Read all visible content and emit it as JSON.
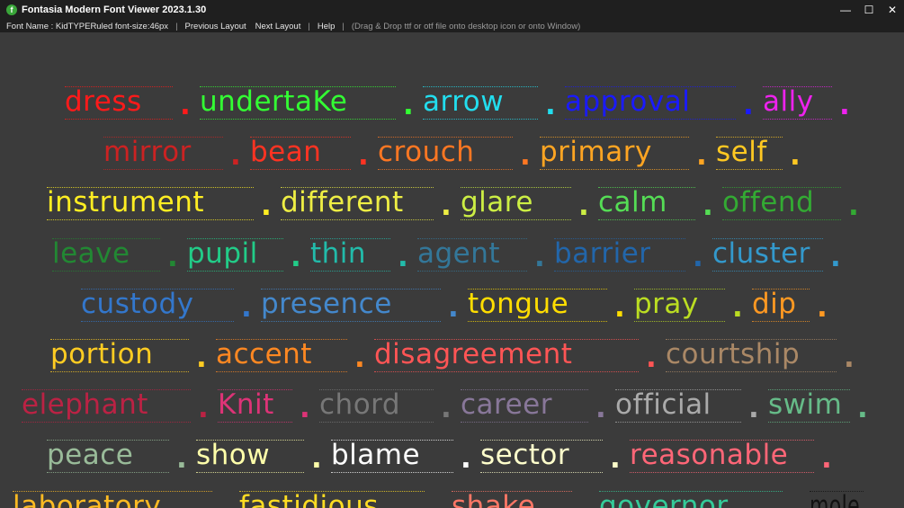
{
  "app": {
    "title": "Fontasia Modern Font Viewer 2023.1.30",
    "icon": "fontasia-logo-icon",
    "icon_letter": "f",
    "icon_color": "#3aa63a"
  },
  "window_controls": {
    "minimize": "—",
    "maximize": "☐",
    "close": "✕"
  },
  "menubar": {
    "font_info": "Font Name : KidTYPERuled font-size:46px",
    "previous_layout": "Previous Layout",
    "next_layout": "Next Layout",
    "help": "Help",
    "hint": "(Drag & Drop ttf or otf file onto desktop icon or onto Window)",
    "separator": "|"
  },
  "sample": {
    "separator_glyph": ".",
    "rows": [
      [
        {
          "text": "dress",
          "color": "#ff1a1a"
        },
        {
          "text": "undertaKe",
          "color": "#33ff33"
        },
        {
          "text": "arrow",
          "color": "#22ddee"
        },
        {
          "text": "approval",
          "color": "#1a1aff"
        },
        {
          "text": "ally",
          "color": "#ee22ee"
        }
      ],
      [
        {
          "text": "mirror",
          "color": "#cc2222"
        },
        {
          "text": "bean",
          "color": "#ff3322"
        },
        {
          "text": "crouch",
          "color": "#ff7722"
        },
        {
          "text": "primary",
          "color": "#ffa522"
        },
        {
          "text": "self",
          "color": "#ffc822"
        }
      ],
      [
        {
          "text": "instrument",
          "color": "#ffee22"
        },
        {
          "text": "different",
          "color": "#eeee44"
        },
        {
          "text": "glare",
          "color": "#ccee44"
        },
        {
          "text": "calm",
          "color": "#55dd55"
        },
        {
          "text": "offend",
          "color": "#33aa33"
        }
      ],
      [
        {
          "text": "leave",
          "color": "#228833"
        },
        {
          "text": "pupil",
          "color": "#22cc88"
        },
        {
          "text": "thin",
          "color": "#22bbaa"
        },
        {
          "text": "agent",
          "color": "#337799"
        },
        {
          "text": "barrier",
          "color": "#2266aa"
        },
        {
          "text": "cluster",
          "color": "#3399cc"
        }
      ],
      [
        {
          "text": "custody",
          "color": "#3377cc"
        },
        {
          "text": "presence",
          "color": "#4488cc"
        },
        {
          "text": "tongue",
          "color": "#ffdd00"
        },
        {
          "text": "pray",
          "color": "#bbdd22"
        },
        {
          "text": "dip",
          "color": "#ff9922"
        }
      ],
      [
        {
          "text": "portion",
          "color": "#ffcc22"
        },
        {
          "text": "accent",
          "color": "#ff8822"
        },
        {
          "text": "disagreement",
          "color": "#ff5555"
        },
        {
          "text": "courtship",
          "color": "#aa8866"
        }
      ],
      [
        {
          "text": "elephant",
          "color": "#bb2244"
        },
        {
          "text": "Knit",
          "color": "#dd3377"
        },
        {
          "text": "chord",
          "color": "#777777"
        },
        {
          "text": "career",
          "color": "#887799"
        },
        {
          "text": "official",
          "color": "#aaaaaa"
        },
        {
          "text": "swim",
          "color": "#66bb88"
        }
      ],
      [
        {
          "text": "peace",
          "color": "#99bb99"
        },
        {
          "text": "show",
          "color": "#ffffaa"
        },
        {
          "text": "blame",
          "color": "#ffffff"
        },
        {
          "text": "sector",
          "color": "#ffffcc"
        },
        {
          "text": "reasonable",
          "color": "#ff6677"
        }
      ],
      [
        {
          "text": "laboratory",
          "color": "#ffbb22"
        },
        {
          "text": "fastidious",
          "color": "#ffdd22"
        },
        {
          "text": "shake",
          "color": "#ff7766"
        },
        {
          "text": "governor",
          "color": "#33cc99"
        },
        {
          "text": "mole",
          "color": "#111111"
        }
      ]
    ]
  }
}
